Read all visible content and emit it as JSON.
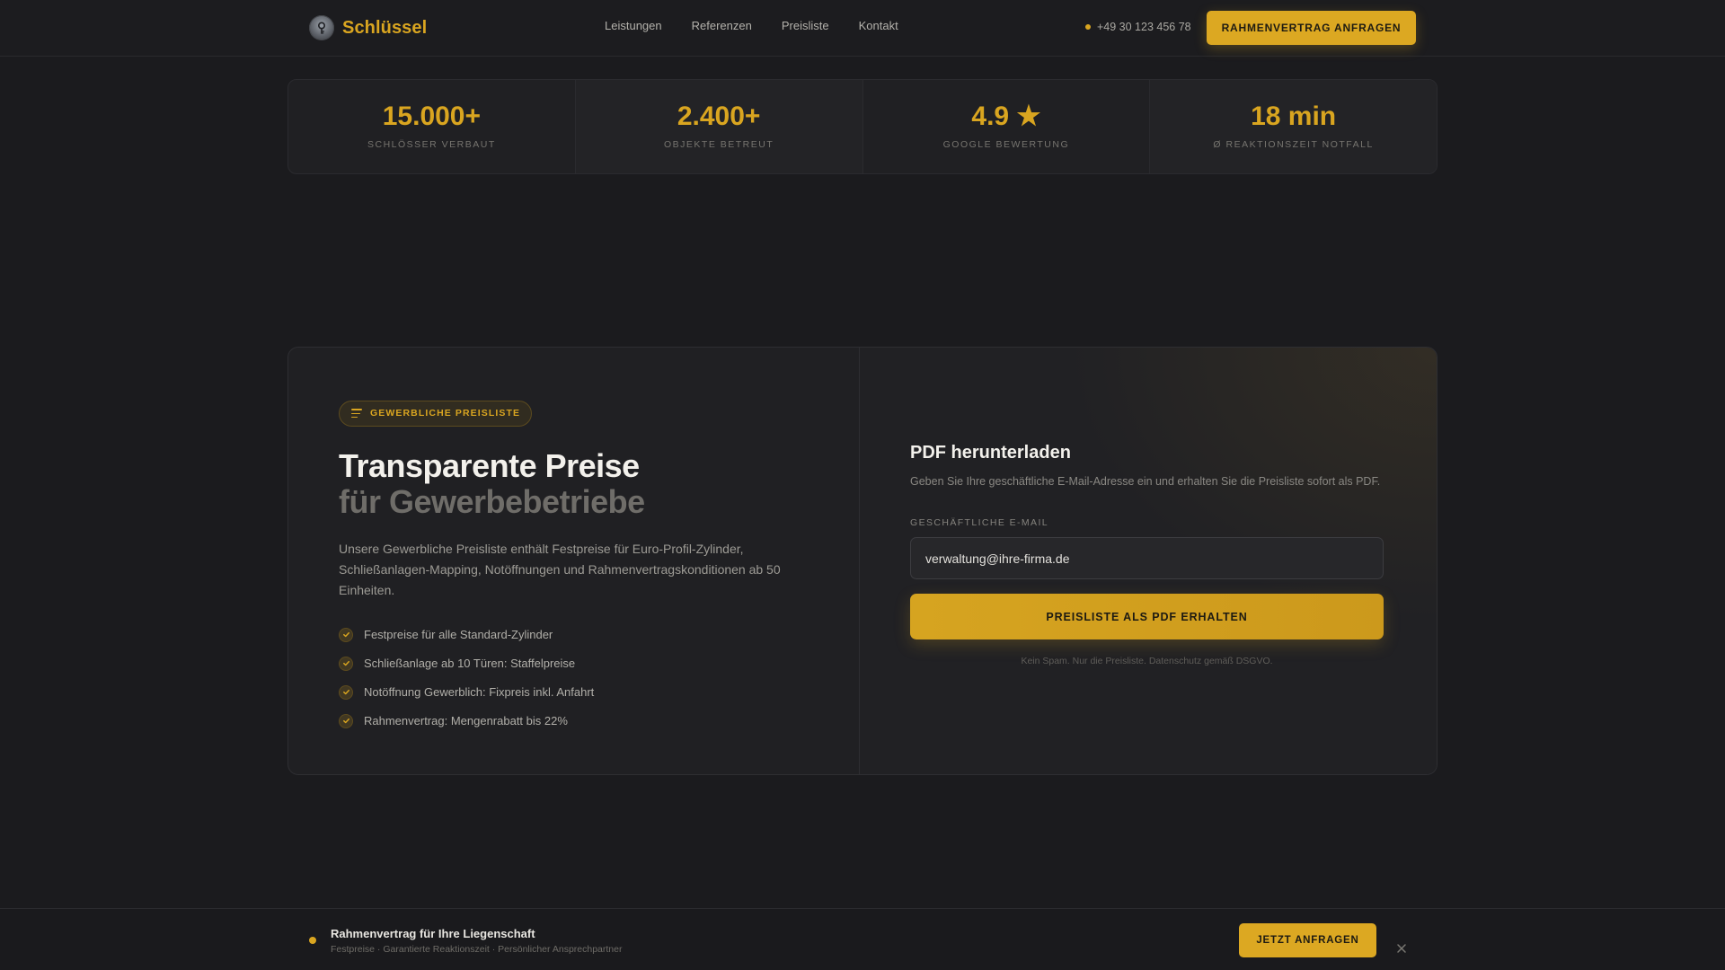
{
  "colors": {
    "accent": "#d9a520",
    "background": "#1b1b1e"
  },
  "nav": {
    "brand": "Schlüssel",
    "logo_icon": "key-emblem-icon",
    "links": [
      "Leistungen",
      "Referenzen",
      "Preisliste",
      "Kontakt"
    ],
    "phone": "+49 30 123 456 78",
    "cta": "RAHMENVERTRAG ANFRAGEN"
  },
  "stats": [
    {
      "value": "15.000+",
      "label": "SCHLÖSSER VERBAUT"
    },
    {
      "value": "2.400+",
      "label": "OBJEKTE BETREUT"
    },
    {
      "value": "4.9 ★",
      "label": "GOOGLE BEWERTUNG"
    },
    {
      "value": "18 min",
      "label": "Ø REAKTIONSZEIT NOTFALL"
    }
  ],
  "pricing": {
    "badge": "GEWERBLICHE PREISLISTE",
    "badge_icon": "list-icon",
    "title": "Transparente Preise",
    "subtitle": "für Gewerbebetriebe",
    "lead": "Unsere Gewerbliche Preisliste enthält Festpreise für Euro-Profil-Zylinder, Schließanlagen-Mapping, Notöffnungen und Rahmenvertragskonditionen ab 50 Einheiten.",
    "features": [
      "Festpreise für alle Standard-Zylinder",
      "Schließanlage ab 10 Türen: Staffelpreise",
      "Notöffnung Gewerblich: Fixpreis inkl. Anfahrt",
      "Rahmenvertrag: Mengenrabatt bis 22%"
    ]
  },
  "form": {
    "title": "PDF herunterladen",
    "description": "Geben Sie Ihre geschäftliche E-Mail-Adresse ein und erhalten Sie die Preisliste sofort als PDF.",
    "email_label": "GESCHÄFTLICHE E-MAIL",
    "email_value": "verwaltung@ihre-firma.de",
    "submit": "PREISLISTE ALS PDF ERHALTEN",
    "fine_print": "Kein Spam. Nur die Preisliste. Datenschutz gemäß DSGVO."
  },
  "bottombar": {
    "title": "Rahmenvertrag für Ihre Liegenschaft",
    "subtitle": "Festpreise · Garantierte Reaktionszeit · Persönlicher Ansprechpartner",
    "cta": "JETZT ANFRAGEN",
    "close_icon": "close-icon"
  }
}
